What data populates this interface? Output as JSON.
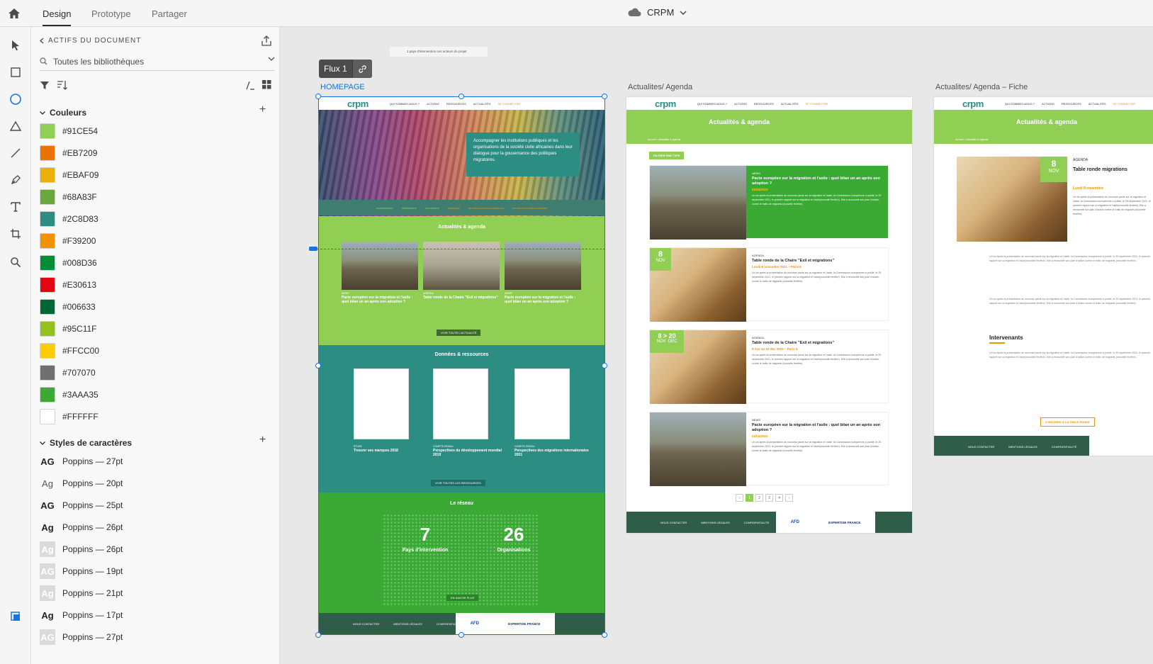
{
  "app": {
    "tabs": [
      "Design",
      "Prototype",
      "Partager"
    ],
    "doc_title": "CRPM"
  },
  "panel": {
    "header": "ACTIFS DU DOCUMENT",
    "search_value": "Toutes les bibliothèques",
    "colors_title": "Couleurs",
    "colors": [
      "#91CE54",
      "#EB7209",
      "#EBAF09",
      "#68A83F",
      "#2C8D83",
      "#F39200",
      "#008D36",
      "#E30613",
      "#006633",
      "#95C11F",
      "#FFCC00",
      "#707070",
      "#3AAA35",
      "#FFFFFF"
    ],
    "char_styles_title": "Styles de caractères",
    "char_styles": [
      {
        "glyph": "AG",
        "label": "Poppins — 27pt"
      },
      {
        "glyph": "Ag",
        "label": "Poppins — 20pt"
      },
      {
        "glyph": "AG",
        "label": "Poppins — 25pt"
      },
      {
        "glyph": "Ag",
        "label": "Poppins — 26pt"
      },
      {
        "glyph": "Ag",
        "label": "Poppins — 26pt"
      },
      {
        "glyph": "AG",
        "label": "Poppins — 19pt"
      },
      {
        "glyph": "Ag",
        "label": "Poppins — 21pt"
      },
      {
        "glyph": "Ag",
        "label": "Poppins — 17pt"
      },
      {
        "glyph": "AG",
        "label": "Poppins — 27pt"
      }
    ]
  },
  "canvas": {
    "flow_label": "Flux 1",
    "top_snippet": "1 pays d'intervention    Les acteurs du projet",
    "artboards": {
      "home": "HOMEPAGE",
      "agenda": "Actualites/ Agenda",
      "fiche": "Actualites/ Agenda – Fiche"
    }
  },
  "site": {
    "logo": "crpm",
    "nav": [
      "QUI SOMMES-NOUS ?",
      "ACTIONS",
      "RESSOURCES",
      "ACTUALITÉS",
      "SE CONNECTER"
    ],
    "hero_text": "Accompagner les institutions publiques et les organisations de la société civile africaines dans leur dialogue pour la gouvernance des politiques migratoires.",
    "tags": [
      "#sociétécivile",
      "#institutions",
      "#recherche",
      "#dialogue",
      "#productiondeconnaissance",
      "#renforcementdescapacités"
    ],
    "news_title": "Actualités & agenda",
    "news_cards": [
      {
        "kind": "NEWS",
        "title": "Pacte européen sur la migration et l'asile : quel bilan un an après son adoption ?"
      },
      {
        "kind": "AGENDA",
        "title": "Table ronde de la Chaire \"Exil et migrations\""
      },
      {
        "kind": "NEWS",
        "title": "Pacte européen sur la migration et l'asile : quel bilan un an après son adoption ?"
      }
    ],
    "news_btn": "VOIR TOUTE L'ACTUALITÉ",
    "res_title": "Données & ressources",
    "res_cards": [
      {
        "kind": "ÉTUDE",
        "title": "Trouver ses marques 2018"
      },
      {
        "kind": "COMPTE-RENDU",
        "title": "Perspectives du développement mondial 2019"
      },
      {
        "kind": "COMPTE-RENDU",
        "title": "Perspectives des migrations internationales 2021"
      }
    ],
    "res_btn": "VOIR TOUTES LES RESSOURCES",
    "network_title": "Le réseau",
    "stat1_num": "7",
    "stat1_lbl": "Pays d'intervention",
    "stat2_num": "26",
    "stat2_lbl": "Organisations",
    "network_btn": "EN SAVOIR PLUS",
    "footer": [
      "NOUS CONTACTER",
      "MENTIONS LÉGALES",
      "CONFIDENTIALITÉ"
    ],
    "partners": [
      "AFD",
      "EXPERTISE FRANCE"
    ],
    "agenda_banner": "Actualités & agenda",
    "crumb": "Accueil > Actualités & agenda",
    "filter": "FILTRER PAR TYPE",
    "list": [
      {
        "kind": "NEWS",
        "title": "Pacte européen sur la migration et l'asile : quel bilan un an après son adoption ?",
        "date": "01/04/2022"
      },
      {
        "kind": "AGENDA",
        "title": "Table ronde de la Chaire \"Exil et migrations\"",
        "date": "Lundi 8 novembre 2021 – Paris 6",
        "day": "8",
        "month": "NOV"
      },
      {
        "kind": "AGENDA",
        "title": "Table ronde de la Chaire \"Exil et migrations\"",
        "date": "8 nov au 20 déc 2022 – Paris 6",
        "day": "8 > 20",
        "month": "NOV  DEC"
      },
      {
        "kind": "NEWS",
        "title": "Pacte européen sur la migration et l'asile : quel bilan un an après son adoption ?",
        "date": "01/04/2022"
      }
    ],
    "lorem": "Un an après la présentation du nouveau pacte sur la migration et l'asile, la Commission européenne a publié, le 29 septembre 2021, le premier rapport sur la migration et l'asile(nouvelle fenêtre). Elle a renouvelé son plan d'action contre le trafic de migrants (nouvelle fenêtre).",
    "fiche_kind": "AGENDA",
    "fiche_title": "Table ronde migrations",
    "fiche_date": "Lundi 8 novembre",
    "fiche_day": "8",
    "fiche_month": "NOV",
    "intervenants": "Intervenants",
    "fiche_btn": "S'INSCRIRE À LA TABLE RONDE"
  }
}
